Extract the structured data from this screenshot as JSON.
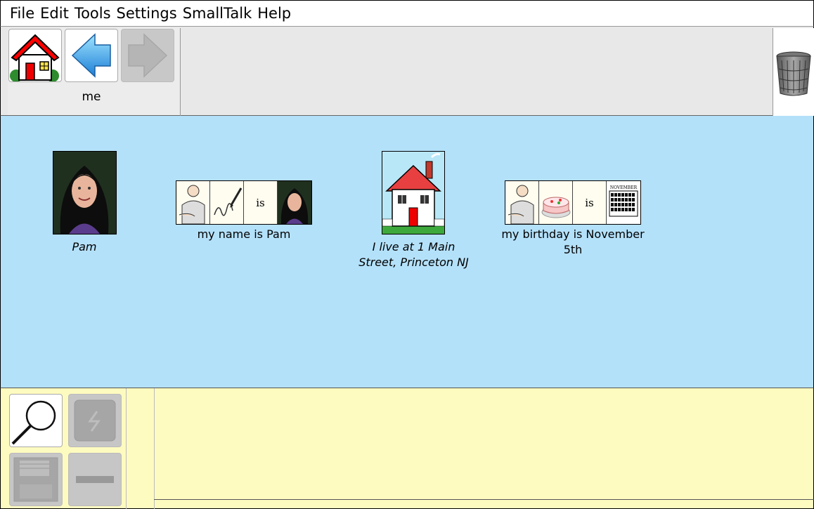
{
  "menu": [
    "File",
    "Edit",
    "Tools",
    "Settings",
    "SmallTalk",
    "Help"
  ],
  "toolbar": {
    "home_icon": "house-icon",
    "back_icon": "back-arrow-icon",
    "forward_icon": "forward-arrow-icon",
    "nav_label": "me",
    "trash_icon": "trash-can-icon"
  },
  "items": [
    {
      "caption": "Pam",
      "icon": "photo-of-pam"
    },
    {
      "caption": "my name is Pam",
      "icons": [
        "person",
        "signature",
        "is",
        "photo-of-pam"
      ],
      "is_text": "is"
    },
    {
      "caption": "I live at 1 Main Street, Princeton NJ",
      "icon": "house-icon"
    },
    {
      "caption": "my birthday is November 5th",
      "icons": [
        "person",
        "birthday-cake",
        "is",
        "november-calendar"
      ],
      "is_text": "is",
      "calendar_label": "NOVEMBER"
    }
  ],
  "bottom": {
    "tools": [
      "magnifier-icon",
      "edit-disabled-icon",
      "save-disabled-icon",
      "delete-disabled-icon"
    ]
  },
  "colors": {
    "main_bg": "#b4e1fa",
    "bottom_bg": "#fefbc0",
    "toolbar_bg": "#e8e8e8"
  }
}
